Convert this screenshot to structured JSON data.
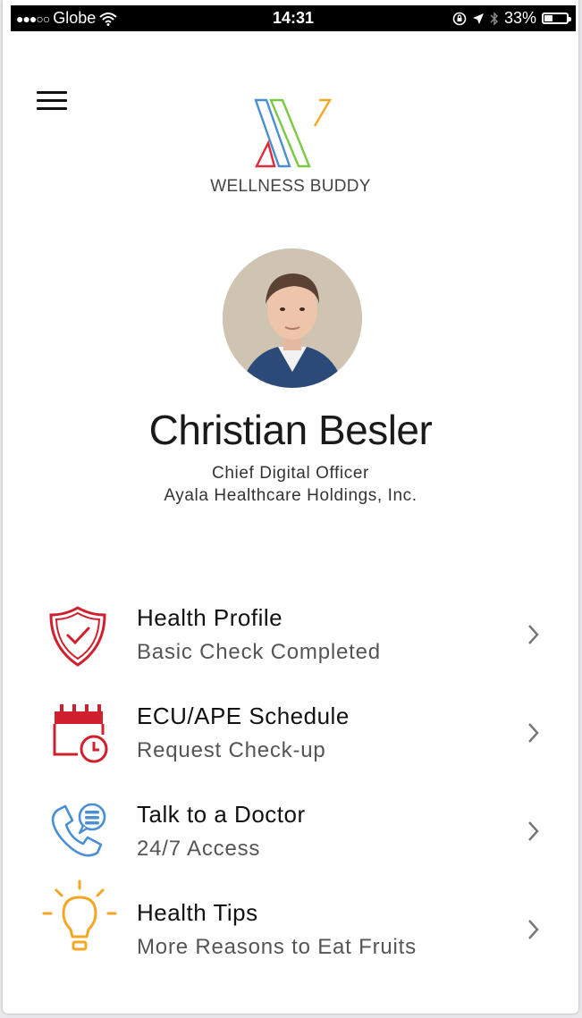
{
  "status_bar": {
    "carrier": "Globe",
    "time": "14:31",
    "battery": "33%",
    "signal_dots": "●●●○○"
  },
  "app": {
    "brand": "WELLNESS BUDDY",
    "logo_colors": [
      "#4a8fd6",
      "#e02a3a",
      "#7ac943",
      "#f5a623"
    ]
  },
  "profile": {
    "name": "Christian Besler",
    "title": "Chief Digital Officer",
    "company": "Ayala Healthcare Holdings, Inc."
  },
  "menu": {
    "items": [
      {
        "label": "Health Profile",
        "sub": "Basic Check Completed",
        "icon": "shield-check-icon",
        "color": "#d0202e"
      },
      {
        "label": "ECU/APE Schedule",
        "sub": "Request Check-up",
        "icon": "calendar-clock-icon",
        "color": "#d0202e"
      },
      {
        "label": "Talk to a Doctor",
        "sub": "24/7 Access",
        "icon": "phone-chat-icon",
        "color": "#4a8fd6"
      },
      {
        "label": "Health Tips",
        "sub": "More Reasons to Eat Fruits",
        "icon": "lightbulb-icon",
        "color": "#f5a623"
      }
    ]
  }
}
